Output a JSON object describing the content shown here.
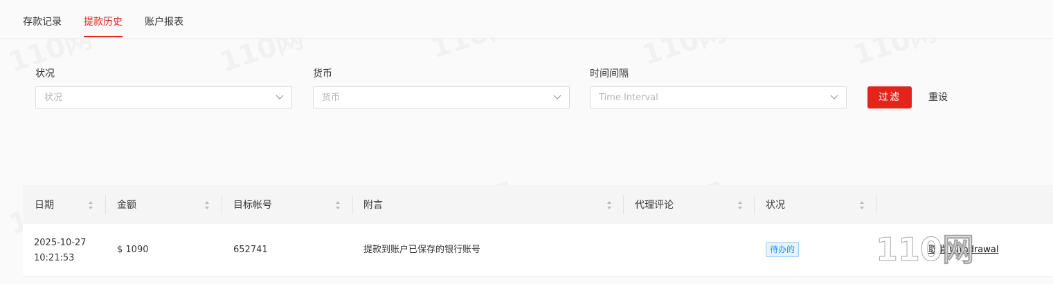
{
  "tabs": [
    {
      "label": "存款记录",
      "active": false
    },
    {
      "label": "提款历史",
      "active": true
    },
    {
      "label": "账户报表",
      "active": false
    }
  ],
  "filters": {
    "status": {
      "label": "状况",
      "placeholder": "状况"
    },
    "currency": {
      "label": "货币",
      "placeholder": "货币"
    },
    "interval": {
      "label": "时间间隔",
      "placeholder": "Time Interval"
    },
    "filter_button": "过滤",
    "reset_button": "重设"
  },
  "table": {
    "columns": [
      "日期",
      "金额",
      "目标帐号",
      "附言",
      "代理评论",
      "状况"
    ],
    "rows": [
      {
        "date": "2025-10-27",
        "time": "10:21:53",
        "amount": "$ 1090",
        "account": "652741",
        "note": "提款到账户已保存的银行账号",
        "agent_comment": "",
        "status": "待办的",
        "cancel_link": "取消 withdrawal"
      }
    ]
  },
  "watermark": {
    "text": "110网",
    "corner": "110网"
  },
  "colors": {
    "accent": "#e1251b",
    "badge": "#1890ff"
  }
}
